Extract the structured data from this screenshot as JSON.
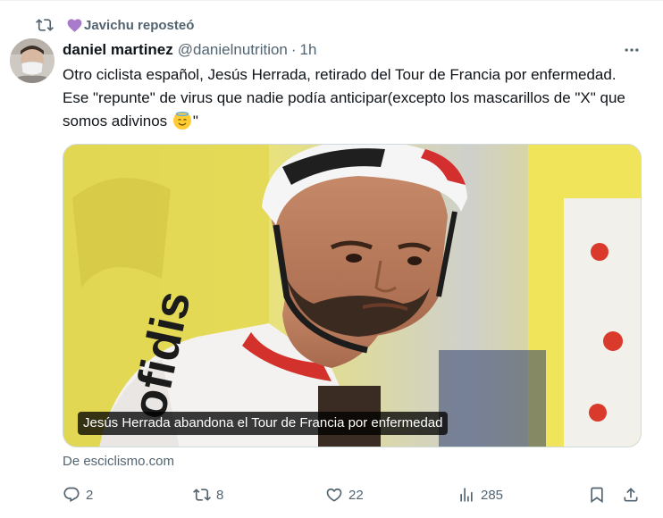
{
  "repost": {
    "label": "Javichu reposteó",
    "icon": "repost-icon",
    "heart_icon": "purple-heart-icon",
    "heart_color": "#a77bca"
  },
  "author": {
    "name": "daniel martinez",
    "handle": "@danielnutrition",
    "separator": "·",
    "time": "1h",
    "avatar": "avatar-photo"
  },
  "tweet": {
    "text_main": "Otro ciclista español, Jesús Herrada, retirado del Tour de Francia por enfermedad. Ese \"repunte\" de virus que nadie podía anticipar(excepto los mascarillos de \"X\" que somos adivinos ",
    "emoji": "smiling-face-with-halo-emoji",
    "text_end": "\""
  },
  "media": {
    "caption": "Jesús Herrada abandona el Tour de Francia por enfermedad",
    "jersey_text": "ofidis"
  },
  "source": "De esciclismo.com",
  "actions": {
    "reply_count": "2",
    "repost_count": "8",
    "like_count": "22",
    "views_count": "285"
  },
  "colors": {
    "text_primary": "#0f1419",
    "text_secondary": "#536471",
    "border": "#cfd9de"
  }
}
